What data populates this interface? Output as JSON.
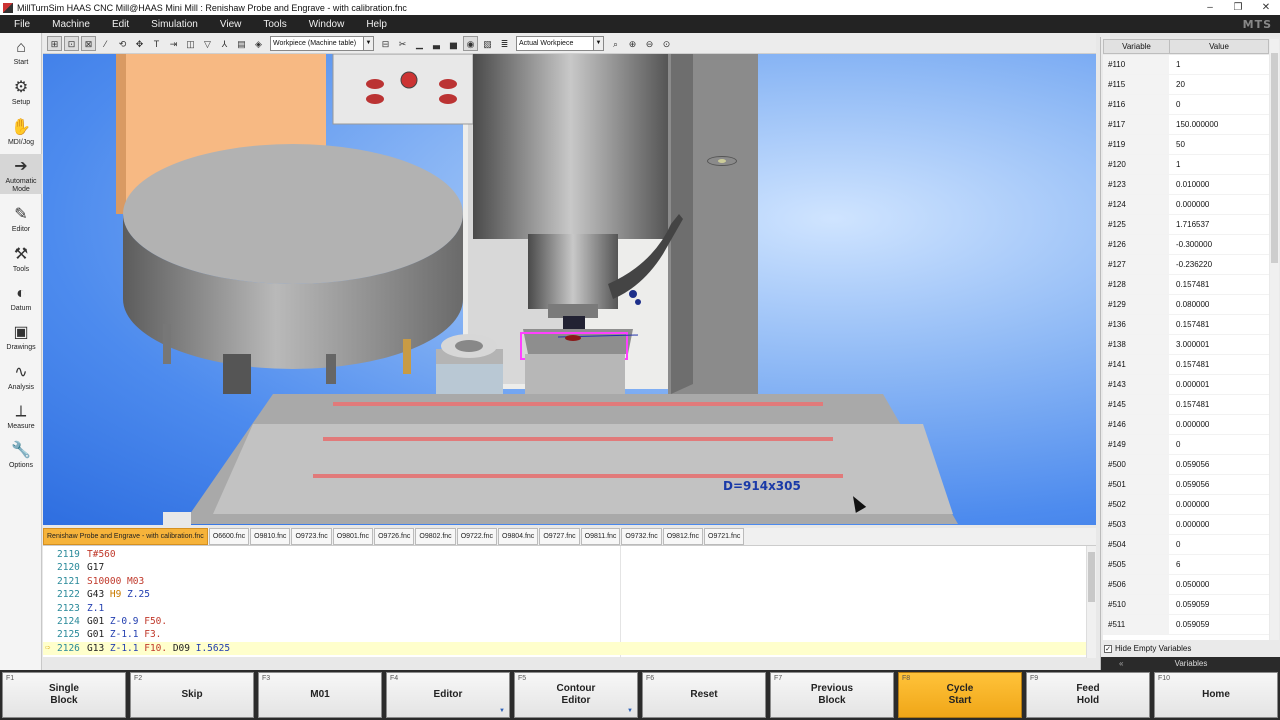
{
  "window": {
    "title": "MillTurnSim HAAS CNC Mill@HAAS Mini Mill : Renishaw Probe and Engrave - with calibration.fnc",
    "controls": [
      "–",
      "❐",
      "✕"
    ]
  },
  "menu": [
    "File",
    "Machine",
    "Edit",
    "Simulation",
    "View",
    "Tools",
    "Window",
    "Help"
  ],
  "brand": "MTS",
  "sidebar": [
    {
      "label": "Start",
      "icon": "home-icon",
      "glyph": "⌂"
    },
    {
      "label": "Setup",
      "icon": "setup-icon",
      "glyph": "⚙"
    },
    {
      "label": "MDI/Jog",
      "icon": "hand-icon",
      "glyph": "✋"
    },
    {
      "label": "Automatic Mode",
      "icon": "arrow-right-icon",
      "glyph": "➔",
      "active": true
    },
    {
      "label": "Editor",
      "icon": "edit-icon",
      "glyph": "✎"
    },
    {
      "label": "Tools",
      "icon": "tool-icon",
      "glyph": "⚒"
    },
    {
      "label": "Datum",
      "icon": "datum-icon",
      "glyph": "◐"
    },
    {
      "label": "Drawings",
      "icon": "drawings-icon",
      "glyph": "▣"
    },
    {
      "label": "Analysis",
      "icon": "analysis-icon",
      "glyph": "∿"
    },
    {
      "label": "Measure",
      "icon": "measure-icon",
      "glyph": "⟂"
    },
    {
      "label": "Options",
      "icon": "wrench-icon",
      "glyph": "🔧"
    }
  ],
  "toolbar": {
    "workpiece_select": "Workpiece (Machine table)",
    "actual_select": "Actual Workpiece"
  },
  "viewport": {
    "dimension_label": "D=914x305"
  },
  "file_tabs": [
    "Renishaw Probe and Engrave - with calibration.fnc",
    "O6600.fnc",
    "O9810.fnc",
    "O9723.fnc",
    "O9801.fnc",
    "O9726.fnc",
    "O9802.fnc",
    "O9722.fnc",
    "O9804.fnc",
    "O9727.fnc",
    "O9811.fnc",
    "O9732.fnc",
    "O9812.fnc",
    "O9721.fnc"
  ],
  "code_lines": [
    {
      "ln": "2119",
      "tokens": [
        [
          "T#560",
          "t-red"
        ]
      ]
    },
    {
      "ln": "2120",
      "tokens": [
        [
          "G17",
          "t-black"
        ]
      ]
    },
    {
      "ln": "2121",
      "tokens": [
        [
          "S10000",
          "t-red"
        ],
        [
          " M03",
          "t-red"
        ]
      ]
    },
    {
      "ln": "2122",
      "tokens": [
        [
          "G43",
          "t-black"
        ],
        [
          " H9",
          "t-orange"
        ],
        [
          " Z.25",
          "t-blue"
        ]
      ]
    },
    {
      "ln": "2123",
      "tokens": [
        [
          "Z.1",
          "t-blue"
        ]
      ]
    },
    {
      "ln": "2124",
      "tokens": [
        [
          "G01",
          "t-black"
        ],
        [
          " Z-0.9",
          "t-blue"
        ],
        [
          " F50.",
          "t-red"
        ]
      ]
    },
    {
      "ln": "2125",
      "tokens": [
        [
          "G01",
          "t-black"
        ],
        [
          " Z-1.1",
          "t-blue"
        ],
        [
          " F3.",
          "t-red"
        ]
      ]
    },
    {
      "ln": "2126",
      "tokens": [
        [
          "G13",
          "t-black"
        ],
        [
          " Z-1.1",
          "t-blue"
        ],
        [
          " F10.",
          "t-red"
        ],
        [
          " D09",
          "t-black"
        ],
        [
          " I.5625",
          "t-blue"
        ]
      ],
      "current": true
    }
  ],
  "variables": {
    "header_variable": "Variable",
    "header_value": "Value",
    "rows": [
      [
        "#110",
        "1"
      ],
      [
        "#115",
        "20"
      ],
      [
        "#116",
        "0"
      ],
      [
        "#117",
        "150.000000"
      ],
      [
        "#119",
        "50"
      ],
      [
        "#120",
        "1"
      ],
      [
        "#123",
        "0.010000"
      ],
      [
        "#124",
        "0.000000"
      ],
      [
        "#125",
        "1.716537"
      ],
      [
        "#126",
        "-0.300000"
      ],
      [
        "#127",
        "-0.236220"
      ],
      [
        "#128",
        "0.157481"
      ],
      [
        "#129",
        "0.080000"
      ],
      [
        "#136",
        "0.157481"
      ],
      [
        "#138",
        "3.000001"
      ],
      [
        "#141",
        "0.157481"
      ],
      [
        "#143",
        "0.000001"
      ],
      [
        "#145",
        "0.157481"
      ],
      [
        "#146",
        "0.000000"
      ],
      [
        "#149",
        "0"
      ],
      [
        "#500",
        "0.059056"
      ],
      [
        "#501",
        "0.059056"
      ],
      [
        "#502",
        "0.000000"
      ],
      [
        "#503",
        "0.000000"
      ],
      [
        "#504",
        "0"
      ],
      [
        "#505",
        "6"
      ],
      [
        "#506",
        "0.050000"
      ],
      [
        "#510",
        "0.059059"
      ],
      [
        "#511",
        "0.059059"
      ]
    ],
    "hide_empty_label": "Hide Empty Variables",
    "hide_empty_checked": true,
    "tab_label": "Variables"
  },
  "fkeys": [
    {
      "key": "F1",
      "label": "Single\nBlock"
    },
    {
      "key": "F2",
      "label": "Skip"
    },
    {
      "key": "F3",
      "label": "M01"
    },
    {
      "key": "F4",
      "label": "Editor",
      "dropdown": true
    },
    {
      "key": "F5",
      "label": "Contour\nEditor",
      "dropdown": true
    },
    {
      "key": "F6",
      "label": "Reset"
    },
    {
      "key": "F7",
      "label": "Previous\nBlock"
    },
    {
      "key": "F8",
      "label": "Cycle\nStart",
      "active": true
    },
    {
      "key": "F9",
      "label": "Feed\nHold"
    },
    {
      "key": "F10",
      "label": "Home"
    }
  ]
}
